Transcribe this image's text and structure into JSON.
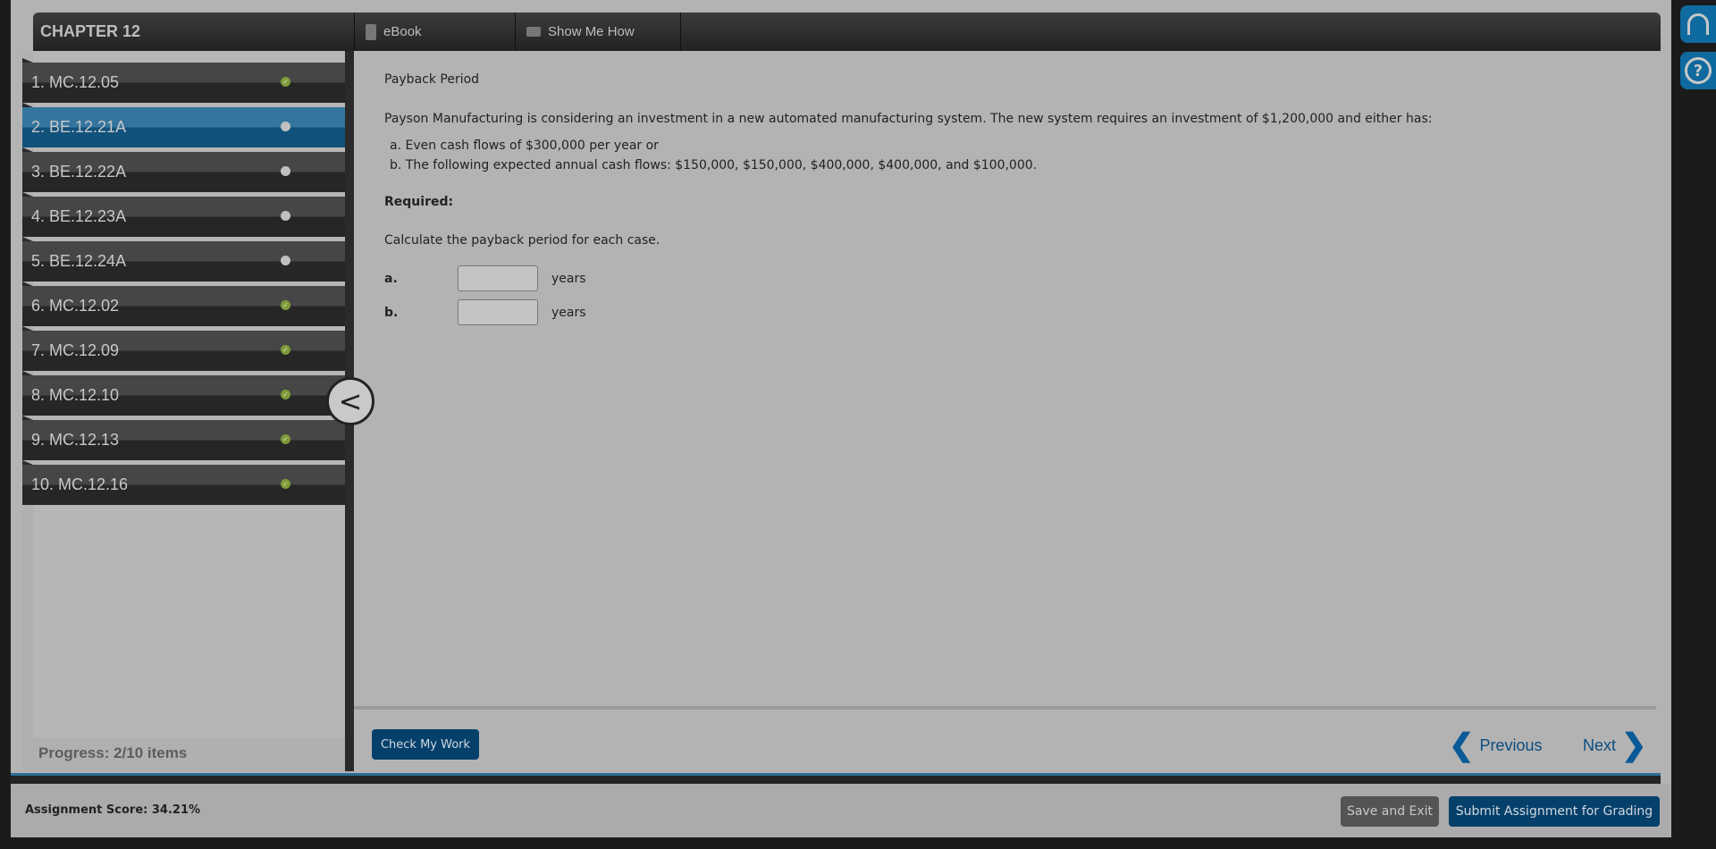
{
  "header": {
    "chapter": "CHAPTER 12",
    "tabs": [
      {
        "label": "eBook",
        "icon": "book-icon"
      },
      {
        "label": "Show Me How",
        "icon": "video-icon"
      }
    ]
  },
  "sidebar": {
    "items": [
      {
        "label": "1. MC.12.05",
        "status": "complete"
      },
      {
        "label": "2. BE.12.21A",
        "status": "incomplete",
        "active": true
      },
      {
        "label": "3. BE.12.22A",
        "status": "incomplete"
      },
      {
        "label": "4. BE.12.23A",
        "status": "incomplete"
      },
      {
        "label": "5. BE.12.24A",
        "status": "incomplete"
      },
      {
        "label": "6. MC.12.02",
        "status": "complete"
      },
      {
        "label": "7. MC.12.09",
        "status": "complete"
      },
      {
        "label": "8. MC.12.10",
        "status": "complete"
      },
      {
        "label": "9. MC.12.13",
        "status": "complete"
      },
      {
        "label": "10. MC.12.16",
        "status": "complete"
      }
    ],
    "progress": "Progress:  2/10 items"
  },
  "content": {
    "title": "Payback Period",
    "intro": "Payson Manufacturing is considering an investment in a new automated manufacturing system. The new system requires an investment of $1,200,000 and either has:",
    "option_a": "a. Even cash flows of $300,000 per year or",
    "option_b": "b. The following expected annual cash flows: $150,000, $150,000, $400,000, $400,000, and $100,000.",
    "required": "Required:",
    "instruction": "Calculate the payback period for each case.",
    "answers": [
      {
        "label": "a.",
        "value": "",
        "unit": "years"
      },
      {
        "label": "b.",
        "value": "",
        "unit": "years"
      }
    ]
  },
  "footer": {
    "check": "Check My Work",
    "previous": "Previous",
    "next": "Next"
  },
  "bottom": {
    "score": "Assignment Score:  34.21%",
    "save": "Save and Exit",
    "submit": "Submit Assignment for Grading"
  },
  "colors": {
    "accent": "#05406b",
    "active_item": "#1f6690",
    "complete": "#7e9a3a"
  }
}
